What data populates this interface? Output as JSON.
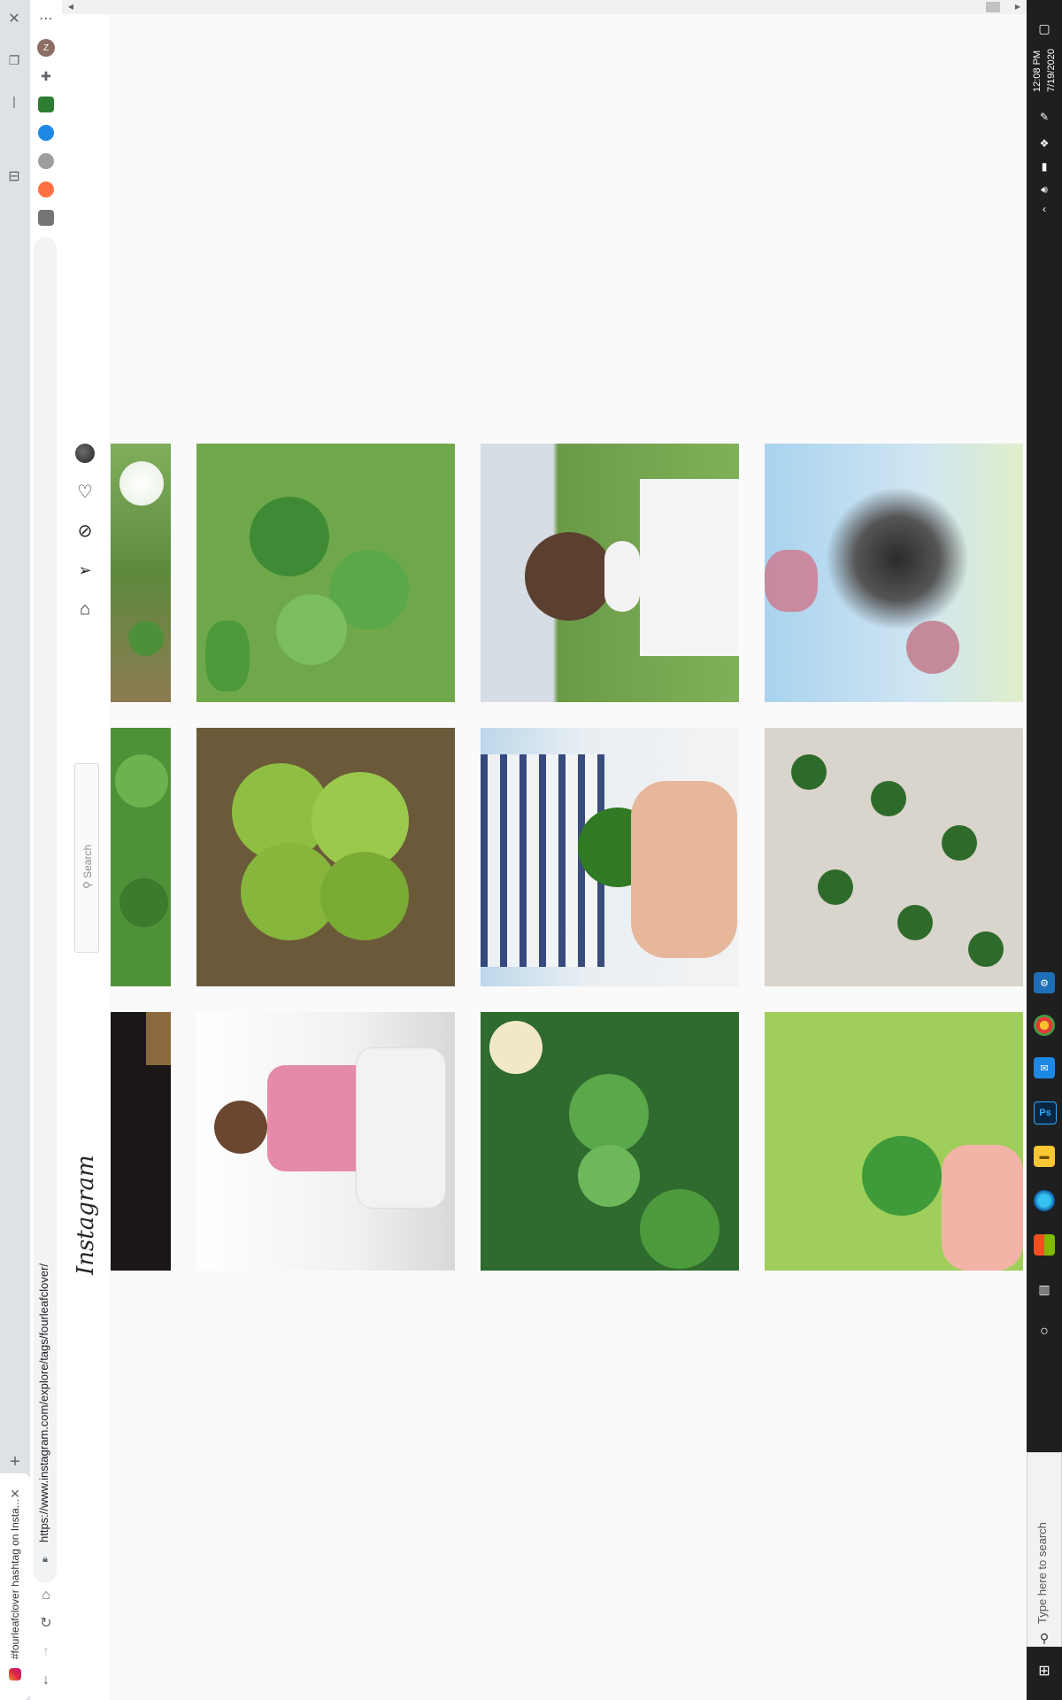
{
  "browser": {
    "tab_title": "#fourleafclover hashtag on Insta...",
    "url": "https://www.instagram.com/explore/tags/fourleafclover/",
    "profile_initial": "Z"
  },
  "instagram": {
    "logo": "Instagram",
    "search_placeholder": "Search"
  },
  "taskbar": {
    "time": "12:08 PM",
    "date": "7/19/2020",
    "search_placeholder": "Type here to search",
    "ps_label": "Ps"
  },
  "photos": [
    {
      "id": "clover-flower-partial",
      "desc": "white clover flower"
    },
    {
      "id": "clover-patch",
      "desc": "green four-leaf clover patch"
    },
    {
      "id": "boy-on-grass",
      "desc": "boy with mask on grass"
    },
    {
      "id": "anime-drawing",
      "desc": "anime drawing"
    },
    {
      "id": "green-leaves-partial",
      "desc": "green leaves"
    },
    {
      "id": "big-clover",
      "desc": "large clover leaf"
    },
    {
      "id": "hand-clover",
      "desc": "hand holding clover"
    },
    {
      "id": "clovers-on-table",
      "desc": "clovers laid on table"
    },
    {
      "id": "dark-partial",
      "desc": "dark image"
    },
    {
      "id": "man-sitting",
      "desc": "man sitting in pink jacket"
    },
    {
      "id": "clover-grass",
      "desc": "clover in grass"
    },
    {
      "id": "fingers-clover",
      "desc": "fingers holding clover"
    }
  ],
  "colors": {
    "taskbar_bg": "#1f1f1f",
    "clover_green": "#4a8f3a",
    "chrome_bg": "#dee1e6"
  }
}
